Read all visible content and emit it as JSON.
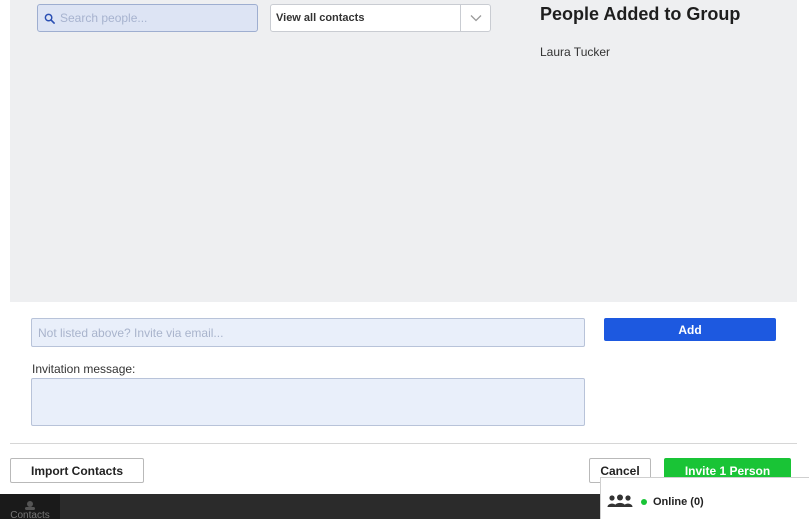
{
  "search": {
    "placeholder": "Search people...",
    "icon": "search-icon"
  },
  "filter": {
    "selected": "View all contacts",
    "icon": "chevron-down-icon"
  },
  "group": {
    "title": "People Added to Group",
    "members": [
      "Laura Tucker"
    ]
  },
  "invite_email": {
    "placeholder": "Not listed above? Invite via email...",
    "value": ""
  },
  "add_label": "Add",
  "invitation": {
    "label": "Invitation message:",
    "value": ""
  },
  "footer": {
    "import_label": "Import Contacts",
    "cancel_label": "Cancel",
    "invite_label": "Invite 1 Person"
  },
  "bottom_bar": {
    "contacts_tab_label": "Contacts",
    "online_label": "Online (0)",
    "online_icon": "people-icon"
  },
  "colors": {
    "accent_blue": "#1d59e0",
    "accent_green": "#19c436",
    "panel_gray": "#eeeff1"
  }
}
